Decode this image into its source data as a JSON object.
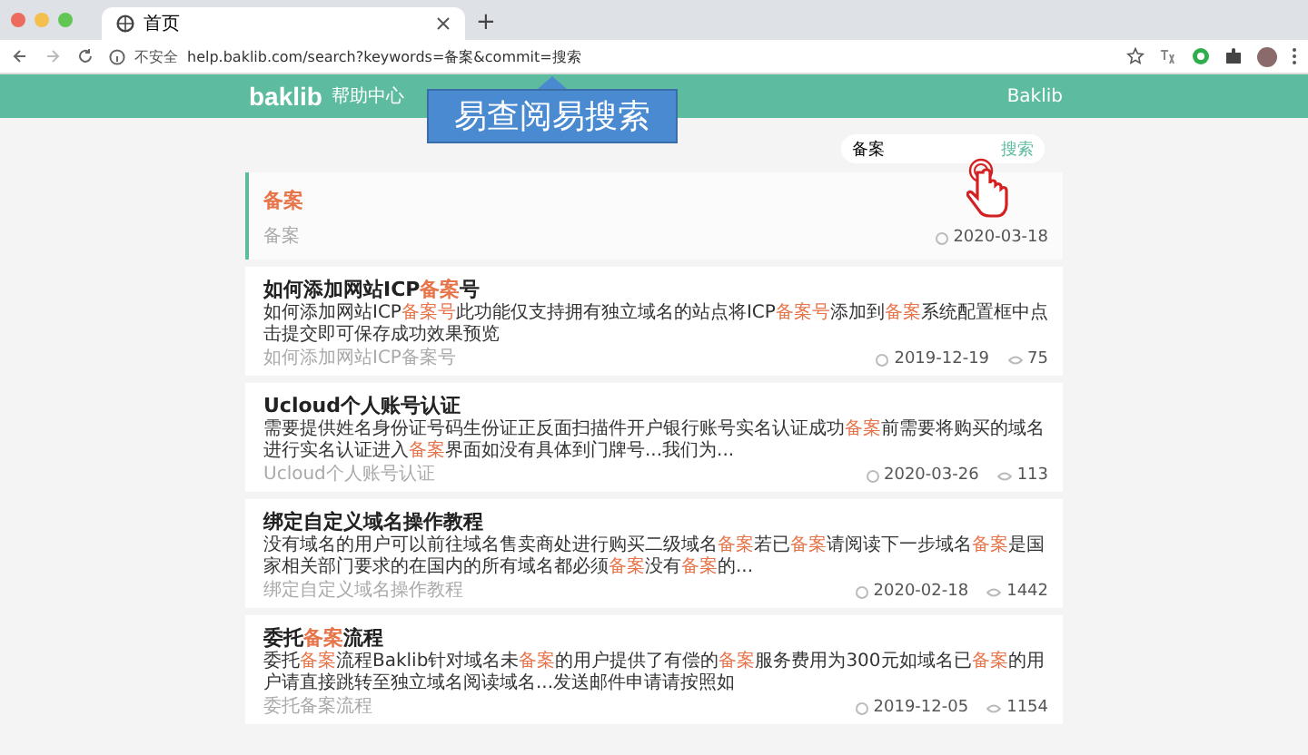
{
  "browser": {
    "tab_title": "首页",
    "new_tab": "+",
    "security": "不安全",
    "url": "help.baklib.com/search?keywords=备案&commit=搜索"
  },
  "header": {
    "logo": "baklib",
    "subtitle": "帮助中心",
    "link": "Baklib"
  },
  "callout": "易查阅易搜索",
  "search": {
    "value": "备案",
    "button": "搜索"
  },
  "results": [
    {
      "selected": true,
      "title": "备案",
      "path": "备案",
      "date": "2020-03-18"
    },
    {
      "selected": false,
      "title": "如何添加网站ICP**备案**号",
      "snippet": "如何添加网站ICP**备案号**此功能仅支持拥有独立域名的站点将ICP**备案号**添加到**备案**系统配置框中点击提交即可保存成功效果预览",
      "path": "如何添加网站ICP备案号",
      "date": "2019-12-19",
      "views": "75"
    },
    {
      "selected": false,
      "title": "Ucloud个人账号认证",
      "snippet": "需要提供姓名身份证号码生份证正反面扫描件开户银行账号实名认证成功**备案**前需要将购买的域名进行实名认证进入**备案**界面如没有具体到门牌号...我们为...",
      "path": "Ucloud个人账号认证",
      "date": "2020-03-26",
      "views": "113"
    },
    {
      "selected": false,
      "title": "绑定自定义域名操作教程",
      "snippet": "没有域名的用户可以前往域名售卖商处进行购买二级域名**备案**若已**备案**请阅读下一步域名**备案**是国家相关部门要求的在国内的所有域名都必须**备案**没有**备案**的...",
      "path": "绑定自定义域名操作教程",
      "date": "2020-02-18",
      "views": "1442"
    },
    {
      "selected": false,
      "title": "委托**备案**流程",
      "snippet": "委托**备案**流程Baklib针对域名未**备案**的用户提供了有偿的**备案**服务费用为300元如域名已**备案**的用户请直接跳转至独立域名阅读域名...发送邮件申请请按照如",
      "path": "委托备案流程",
      "date": "2019-12-05",
      "views": "1154"
    }
  ]
}
